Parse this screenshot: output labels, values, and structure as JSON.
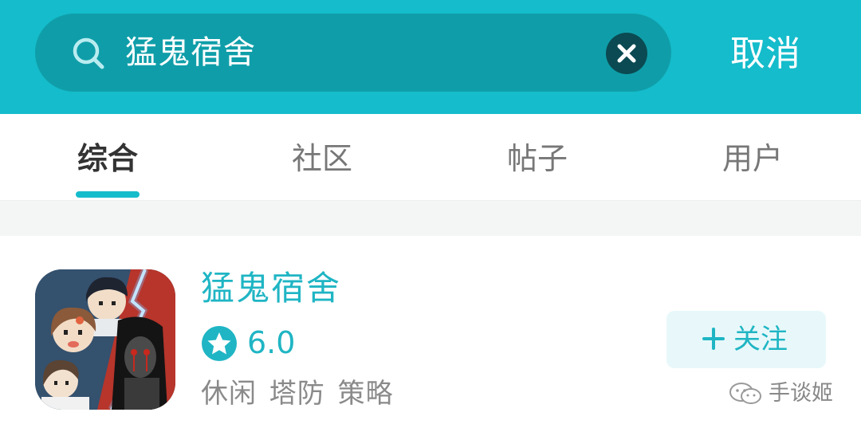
{
  "header": {
    "search_value": "猛鬼宿舍",
    "cancel_label": "取消"
  },
  "tabs": [
    {
      "label": "综合",
      "active": true
    },
    {
      "label": "社区",
      "active": false
    },
    {
      "label": "帖子",
      "active": false
    },
    {
      "label": "用户",
      "active": false
    }
  ],
  "result": {
    "app_name": "猛鬼宿舍",
    "rating": "6.0",
    "tags": "休闲 塔防 策略",
    "follow_label": "关注"
  },
  "watermark": {
    "text": "手谈姬"
  },
  "colors": {
    "accent": "#15bccb",
    "search_bg": "#0f9ea9",
    "text_accent": "#1fb5c4"
  }
}
